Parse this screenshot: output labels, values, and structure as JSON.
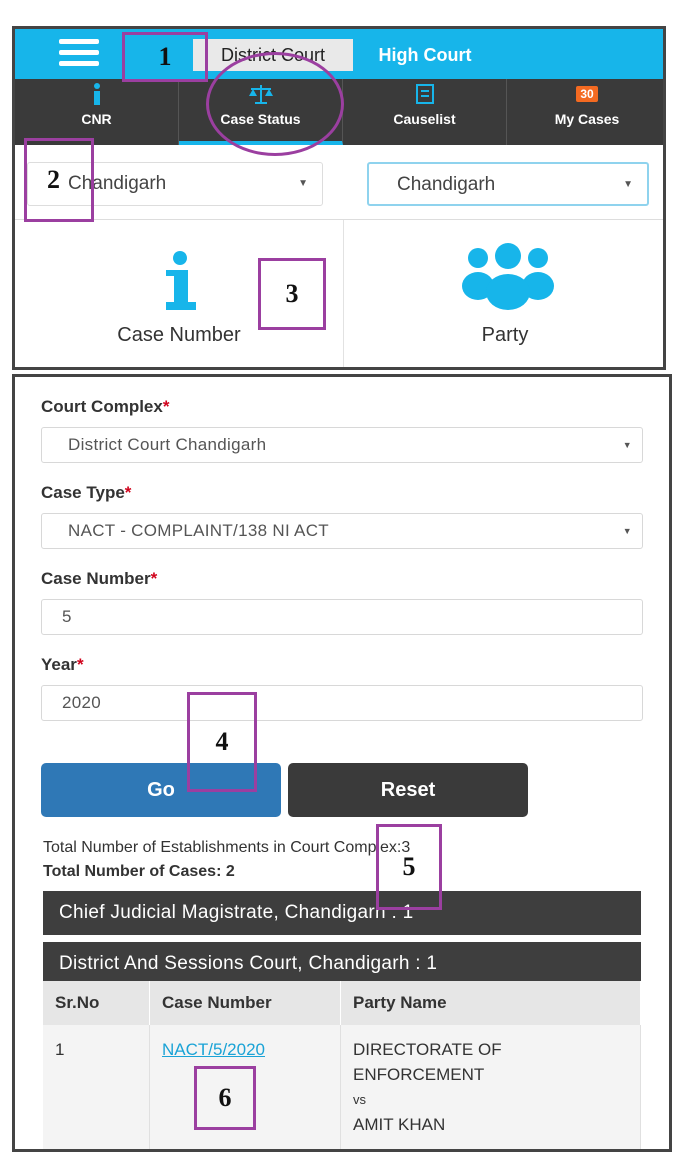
{
  "top": {
    "court_tabs": [
      "District Court",
      "High Court"
    ],
    "menu": [
      {
        "label": "CNR",
        "icon": "info-icon"
      },
      {
        "label": "Case Status",
        "icon": "scales-icon"
      },
      {
        "label": "Causelist",
        "icon": "document-icon"
      },
      {
        "label": "My Cases",
        "icon": "badge-icon",
        "badge": "30"
      }
    ],
    "state_select": "Chandigarh",
    "district_select": "Chandigarh",
    "tiles": [
      {
        "label": "Case Number",
        "icon": "info-icon"
      },
      {
        "label": "Party",
        "icon": "people-icon"
      }
    ]
  },
  "form": {
    "court_complex": {
      "label": "Court Complex",
      "value": "District Court Chandigarh"
    },
    "case_type": {
      "label": "Case Type",
      "value": "NACT - COMPLAINT/138 NI ACT"
    },
    "case_number": {
      "label": "Case Number",
      "value": "5"
    },
    "year": {
      "label": "Year",
      "value": "2020"
    },
    "required_mark": "*",
    "go_label": "Go",
    "reset_label": "Reset"
  },
  "results": {
    "establishments_line": "Total Number of Establishments in Court Complex:3",
    "cases_line": "Total Number of Cases: 2",
    "establishments": [
      "Chief Judicial Magistrate, Chandigarh : 1",
      "District And Sessions Court, Chandigarh : 1"
    ],
    "table": {
      "headers": [
        "Sr.No",
        "Case Number",
        "Party Name"
      ],
      "rows": [
        {
          "sr": "1",
          "case": "NACT/5/2020",
          "party_1": "DIRECTORATE OF",
          "party_2": "ENFORCEMENT",
          "vs": "vs",
          "party_3": "AMIT KHAN"
        }
      ]
    }
  },
  "annotations": [
    "1",
    "2",
    "3",
    "4",
    "5",
    "6"
  ],
  "colors": {
    "topbar": "#17b5ea",
    "menubar": "#3a3a3a",
    "annotation": "#9b3fa0",
    "go_button": "#2f78b6",
    "required": "#d0021b",
    "link": "#1aa3d6"
  }
}
